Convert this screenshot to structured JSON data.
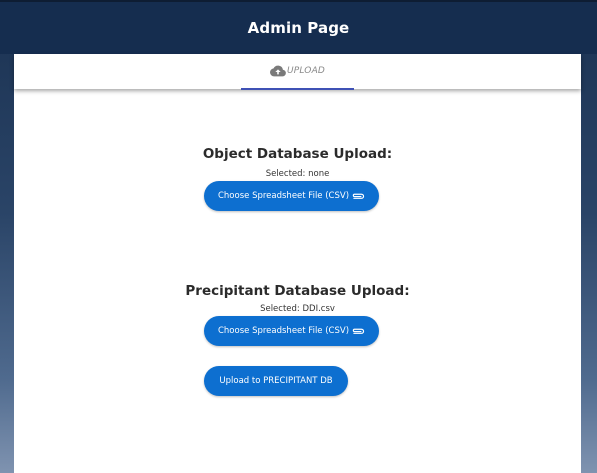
{
  "header": {
    "title": "Admin Page"
  },
  "tabs": [
    {
      "label": "UPLOAD",
      "icon": "cloud-upload-icon",
      "active": true
    }
  ],
  "object_section": {
    "title": "Object Database Upload:",
    "selected": "Selected: none",
    "choose_button": "Choose Spreadsheet File (CSV)",
    "choose_icon": "paperclip-icon"
  },
  "precipitant_section": {
    "title": "Precipitant Database Upload:",
    "selected": "Selected: DDI.csv",
    "choose_button": "Choose Spreadsheet File (CSV)",
    "choose_icon": "paperclip-icon",
    "upload_button": "Upload to PRECIPITANT DB"
  },
  "colors": {
    "header_bg": "#152d4f",
    "button_bg": "#0d6fd0",
    "tab_underline": "#3f51b5"
  }
}
